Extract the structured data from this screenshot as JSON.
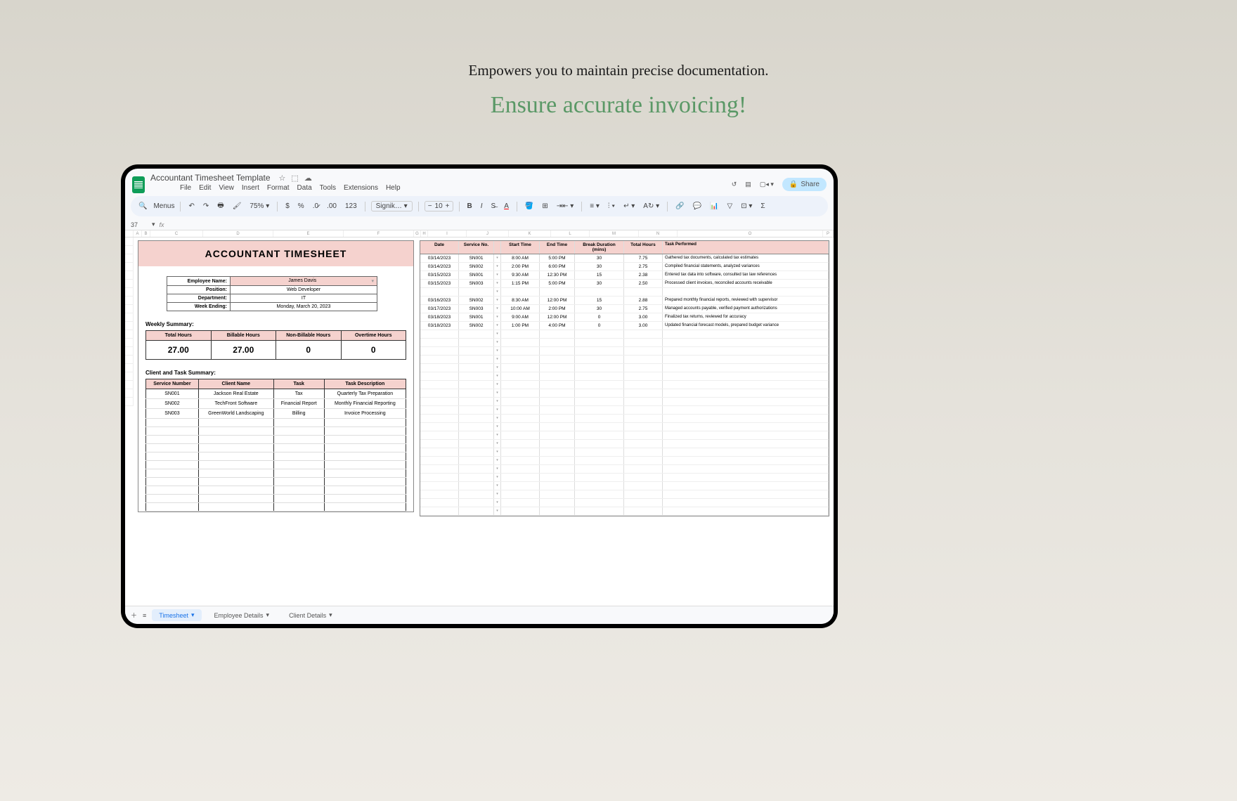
{
  "hero": {
    "subtitle": "Empowers you to maintain precise documentation.",
    "headline": "Ensure accurate invoicing!"
  },
  "doc_title": "Accountant Timesheet Template",
  "menus": [
    "File",
    "Edit",
    "View",
    "Insert",
    "Format",
    "Data",
    "Tools",
    "Extensions",
    "Help"
  ],
  "share_label": "Share",
  "toolbar": {
    "search_menus": "Menus",
    "zoom": "75%",
    "font": "Signik…",
    "font_size": "10"
  },
  "cell_ref": "37",
  "columns": [
    "A",
    "B",
    "C",
    "D",
    "E",
    "F",
    "G",
    "H",
    "I",
    "J",
    "K",
    "L",
    "M",
    "N",
    "O",
    "P"
  ],
  "timesheet": {
    "title": "ACCOUNTANT TIMESHEET",
    "employee_fields": [
      {
        "label": "Employee Name:",
        "value": "James Davis"
      },
      {
        "label": "Position:",
        "value": "Web Developer"
      },
      {
        "label": "Department:",
        "value": "IT"
      },
      {
        "label": "Week Ending:",
        "value": "Monday, March 20, 2023"
      }
    ]
  },
  "weekly_summary": {
    "label": "Weekly Summary:",
    "cols": [
      {
        "head": "Total Hours",
        "val": "27.00"
      },
      {
        "head": "Billable Hours",
        "val": "27.00"
      },
      {
        "head": "Non-Billable Hours",
        "val": "0"
      },
      {
        "head": "Overtime Hours",
        "val": "0"
      }
    ]
  },
  "client_summary": {
    "label": "Client and Task Summary:",
    "headers": [
      "Service Number",
      "Client Name",
      "Task",
      "Task Description"
    ],
    "rows": [
      [
        "SN001",
        "Jackson Real Estate",
        "Tax",
        "Quarterly Tax Preparation"
      ],
      [
        "SN002",
        "TechFront Software",
        "Financial Report",
        "Monthly Financial Reporting"
      ],
      [
        "SN003",
        "GreenWorld Landscaping",
        "Billing",
        "Invoice Processing"
      ]
    ]
  },
  "time_log": {
    "headers": [
      "Date",
      "Service No.",
      "Start Time",
      "End Time",
      "Break Duration (mins)",
      "Total Hours",
      "Task Performed"
    ],
    "rows": [
      [
        "03/14/2023",
        "SN001",
        "8:00 AM",
        "5:00 PM",
        "30",
        "7.75",
        "Gathered tax documents, calculated tax estimates"
      ],
      [
        "03/14/2023",
        "SN002",
        "2:00 PM",
        "6:00 PM",
        "30",
        "2.75",
        "Compiled financial statements, analyzed variances"
      ],
      [
        "03/15/2023",
        "SN001",
        "9:30 AM",
        "12:30 PM",
        "15",
        "2.38",
        "Entered tax data into software, consulted tax law references"
      ],
      [
        "03/15/2023",
        "SN003",
        "1:15 PM",
        "5:00 PM",
        "30",
        "2.50",
        "Processed client invoices, reconciled accounts receivable"
      ]
    ],
    "rows2": [
      [
        "03/16/2023",
        "SN002",
        "8:30 AM",
        "12:00 PM",
        "15",
        "2.88",
        "Prepared monthly financial reports, reviewed with supervisor"
      ],
      [
        "03/17/2023",
        "SN003",
        "10:00 AM",
        "2:00 PM",
        "30",
        "2.75",
        "Managed accounts payable, verified payment authorizations"
      ],
      [
        "03/18/2023",
        "SN001",
        "9:00 AM",
        "12:00 PM",
        "0",
        "3.00",
        "Finalized tax returns, reviewed for accuracy"
      ],
      [
        "03/18/2023",
        "SN002",
        "1:00 PM",
        "4:00 PM",
        "0",
        "3.00",
        "Updated financial forecast models, prepared budget variance"
      ]
    ]
  },
  "sheet_tabs": [
    "Timesheet",
    "Employee Details",
    "Client Details"
  ]
}
